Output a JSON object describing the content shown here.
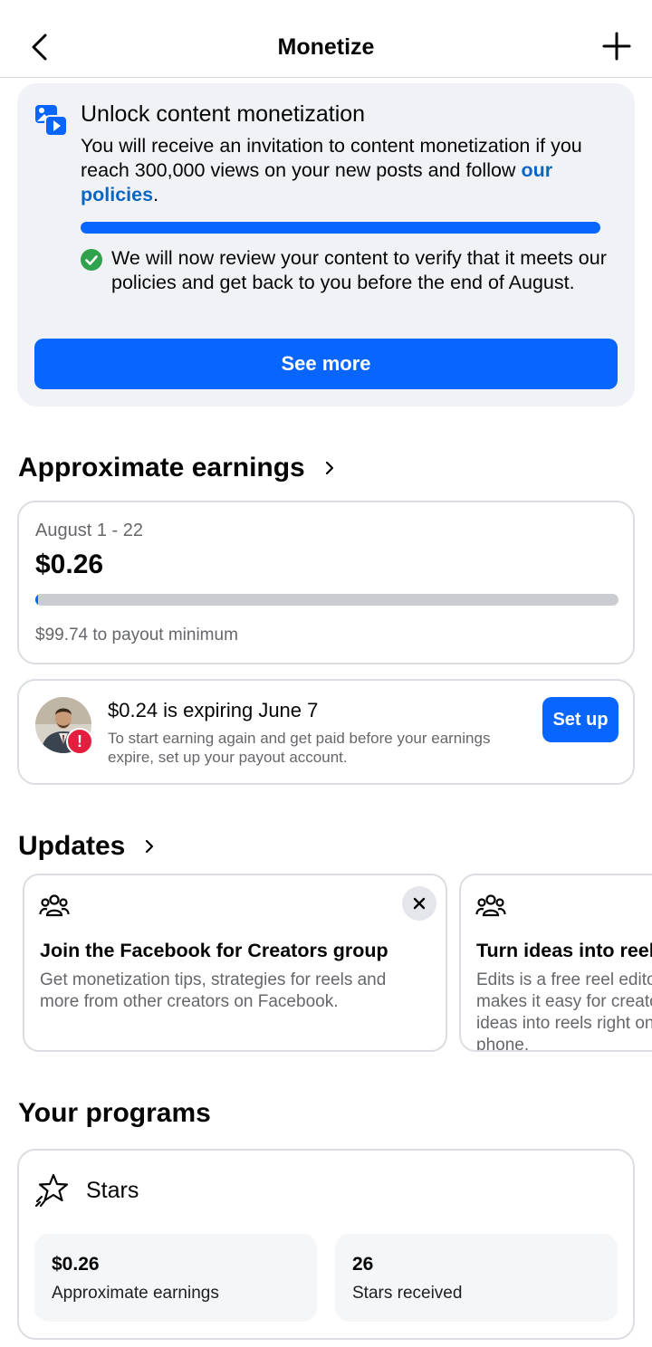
{
  "header": {
    "title": "Monetize"
  },
  "unlock": {
    "title": "Unlock content monetization",
    "body": "You will receive an invitation to content monetization if you reach 300,000 views on your new posts and follow ",
    "policy_link": "our policies",
    "body_end": ".",
    "progress_fraction": 1.0,
    "review_note": "We will now review your content to verify that it meets our policies and get back to you before the end of August.",
    "button": "See more"
  },
  "earnings": {
    "title": "Approximate earnings",
    "date_range": "August 1 - 22",
    "amount": "$0.26",
    "progress_fraction": 0.0026,
    "remaining": "$99.74 to payout minimum"
  },
  "expiring": {
    "title": "$0.24 is expiring June 7",
    "body": "To start earning again and get paid before your earnings expire, set up your payout account.",
    "alert": "!",
    "button": "Set up"
  },
  "updates": {
    "title": "Updates",
    "cards": [
      {
        "title": "Join the Facebook for Creators group",
        "body": "Get monetization tips, strategies for reels and more from other creators on Facebook."
      },
      {
        "title": "Turn ideas into reels",
        "body": "Edits is a free reel editor that makes it easy for creators to turn ideas into reels right on their phone."
      }
    ]
  },
  "programs": {
    "title": "Your programs",
    "stars": {
      "name": "Stars",
      "stats": [
        {
          "value": "$0.26",
          "label": "Approximate earnings"
        },
        {
          "value": "26",
          "label": "Stars received"
        }
      ]
    }
  },
  "colors": {
    "accent": "#0866ff",
    "link": "#0a66c2",
    "success": "#31a24c",
    "alert": "#e41e3f"
  }
}
